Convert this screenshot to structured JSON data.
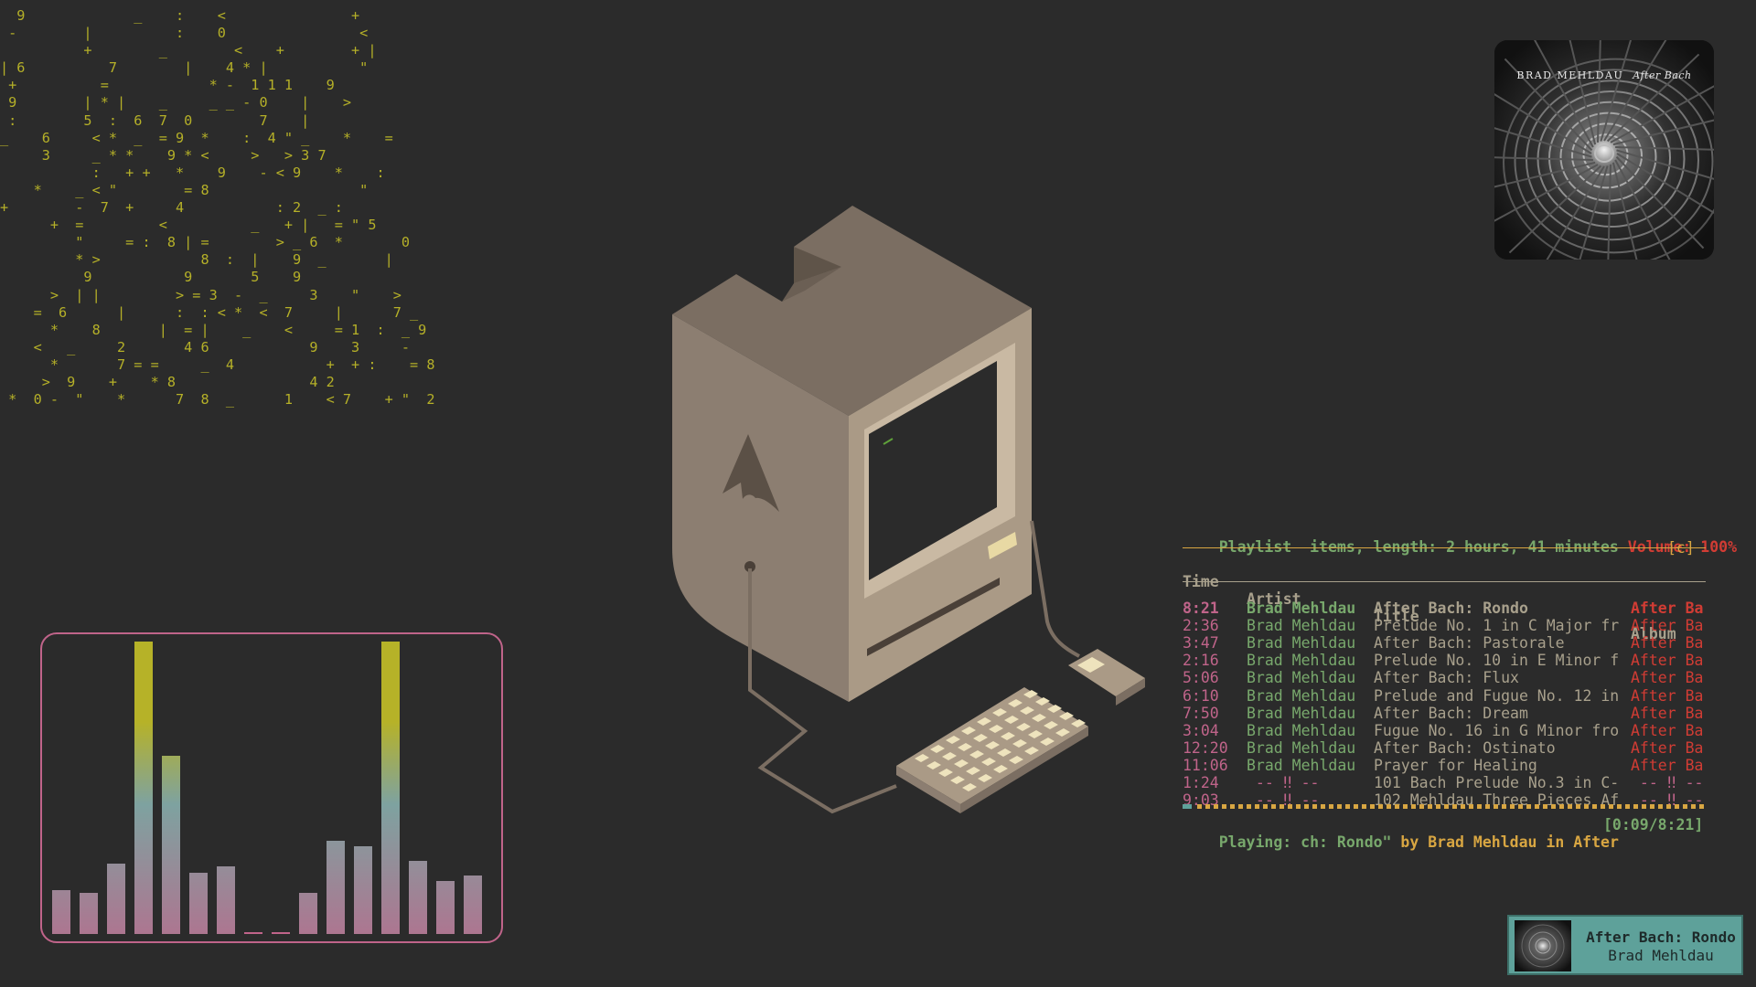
{
  "colors": {
    "background": "#2b2b2b",
    "matrix": "#b5b028",
    "visualizer_border": "#c0648a",
    "visualizer_low": "#c0648a",
    "visualizer_mid": "#7ea2a0",
    "visualizer_high": "#b6b228",
    "playlist_green": "#78a86c",
    "playlist_pink": "#c0648a",
    "playlist_red": "#d13c34",
    "playlist_gold": "#d8a642",
    "notification_bg": "#5ea19a"
  },
  "matrix_lines": [
    "  9             _    :    <               +",
    " -        |          :    0                <",
    "          +        _        <    +        + |",
    "| 6          7        |    4 * |           \"",
    " +          =            * -  1 1 1    9",
    " 9        | * |    _     _ _ - 0    |    >",
    " :        5  :  6  7  0        7    |",
    "_    6     < *  _  = 9  *    :  4 \" _    *    =",
    "     3     _ * *    9 * <     >   > 3 7",
    "           :   + +   *    9    - < 9    *    :",
    "    *    _ < \"        = 8                  \"",
    "+        -  7  +     4           : 2  _ :",
    "      +  =         <          _   + |   = \" 5",
    "         \"     = :  8 | =        > _ 6  *       0",
    "         * >            8  :  |    9  _       |",
    "          9           9       5    9",
    "      >  | |         > = 3  -  _     3    \"    >",
    "    =  6      |      :  : < *  <  7     |      7 _",
    "      *    8       |  = |    _    <     = 1  :  _ 9",
    "    <   _     2       4 6            9    3     -",
    "      *       7 = =     _  4           +  + :    = 8",
    "     >  9    +    * 8                4 2",
    " *  0 -  \"    *      7  8  _      1    < 7    + \"  2"
  ],
  "visualizer": {
    "bars": [
      0.15,
      0.14,
      0.24,
      1.0,
      0.61,
      0.21,
      0.23,
      0,
      0,
      0.14,
      0.32,
      0.3,
      1.0,
      0.25,
      0.18,
      0.2
    ]
  },
  "cover": {
    "artist": "BRAD MEHLDAU",
    "album": "After Bach"
  },
  "player": {
    "header_label": "Playlist",
    "header_info": "  items, length: 2 hours, 41 minutes",
    "volume": "Volume: 100%",
    "mode_flags": "[c]",
    "columns": [
      "Time",
      "Artist",
      "Title",
      "Album"
    ],
    "tracks": [
      {
        "time": "8:21",
        "artist": "Brad Mehldau",
        "title": "After Bach: Rondo",
        "album": "After Ba"
      },
      {
        "time": "2:36",
        "artist": "Brad Mehldau",
        "title": "Prelude No. 1 in C Major fr",
        "album": "After Ba"
      },
      {
        "time": "3:47",
        "artist": "Brad Mehldau",
        "title": "After Bach: Pastorale",
        "album": "After Ba"
      },
      {
        "time": "2:16",
        "artist": "Brad Mehldau",
        "title": "Prelude No. 10 in E Minor f",
        "album": "After Ba"
      },
      {
        "time": "5:06",
        "artist": "Brad Mehldau",
        "title": "After Bach: Flux",
        "album": "After Ba"
      },
      {
        "time": "6:10",
        "artist": "Brad Mehldau",
        "title": "Prelude and Fugue No. 12 in",
        "album": "After Ba"
      },
      {
        "time": "7:50",
        "artist": "Brad Mehldau",
        "title": "After Bach: Dream",
        "album": "After Ba"
      },
      {
        "time": "3:04",
        "artist": "Brad Mehldau",
        "title": "Fugue No. 16 in G Minor fro",
        "album": "After Ba"
      },
      {
        "time": "12:20",
        "artist": "Brad Mehldau",
        "title": "After Bach: Ostinato",
        "album": "After Ba"
      },
      {
        "time": "11:06",
        "artist": "Brad Mehldau",
        "title": "Prayer for Healing",
        "album": "After Ba"
      },
      {
        "time": "1:24",
        "artist": " -- ‼ --",
        "title": "101 Bach Prelude No.3 in C-",
        "album": " -- ‼ --"
      },
      {
        "time": "9:03",
        "artist": " -- ‼ --",
        "title": "102 Mehldau Three Pieces Af",
        "album": " -- ‼ --"
      }
    ],
    "progress": 0.018,
    "status": {
      "label": "Playing: ",
      "title_fragment": "ch: Rondo\"",
      "by": " by ",
      "artist": "Brad Mehldau",
      "in": " in ",
      "album": "After",
      "elapsed": "[0:09/8:21]"
    }
  },
  "notification": {
    "title": "After Bach: Rondo",
    "artist": "Brad Mehldau"
  }
}
